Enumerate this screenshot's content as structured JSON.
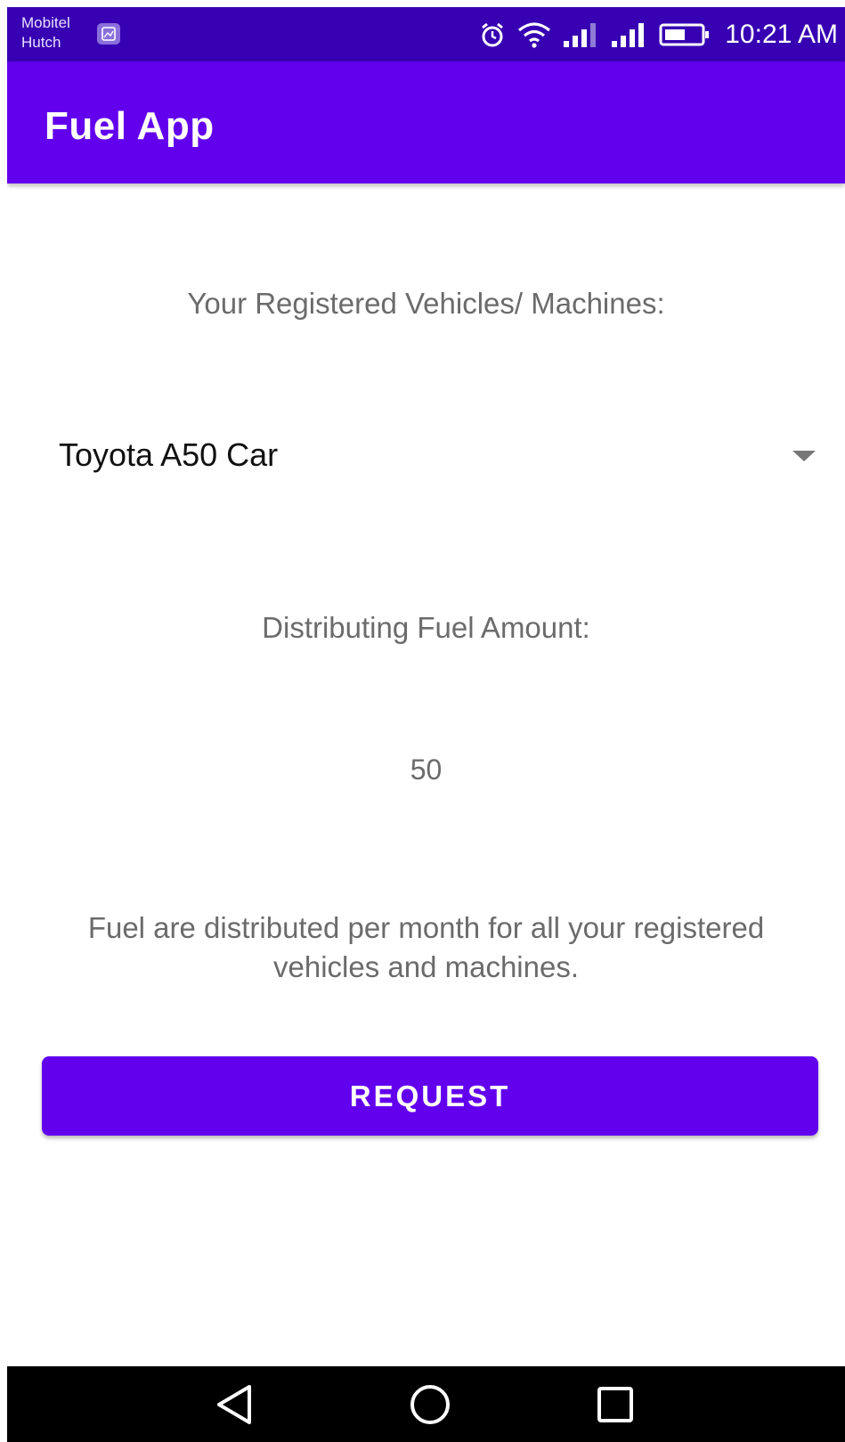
{
  "status_bar": {
    "carrier_line1": "Mobitel",
    "carrier_line2": "Hutch",
    "time": "10:21 AM",
    "icons": [
      "gallery-icon",
      "alarm-icon",
      "wifi-icon",
      "signal-icon",
      "signal-icon",
      "battery-icon"
    ]
  },
  "app_bar": {
    "title": "Fuel App"
  },
  "main": {
    "vehicles_label": "Your Registered Vehicles/ Machines:",
    "vehicle_selected": "Toyota A50 Car",
    "fuel_label": "Distributing Fuel Amount:",
    "fuel_amount": "50",
    "note": "Fuel are distributed per month for all your registered vehicles and machines.",
    "request_button": "REQUEST"
  },
  "nav_bar": {
    "icons": [
      "back-icon",
      "home-icon",
      "recents-icon"
    ]
  },
  "colors": {
    "status_bar": "#3700b3",
    "primary": "#6200ee",
    "secondary_text": "#6b6b6b",
    "nav_bar": "#000000"
  }
}
